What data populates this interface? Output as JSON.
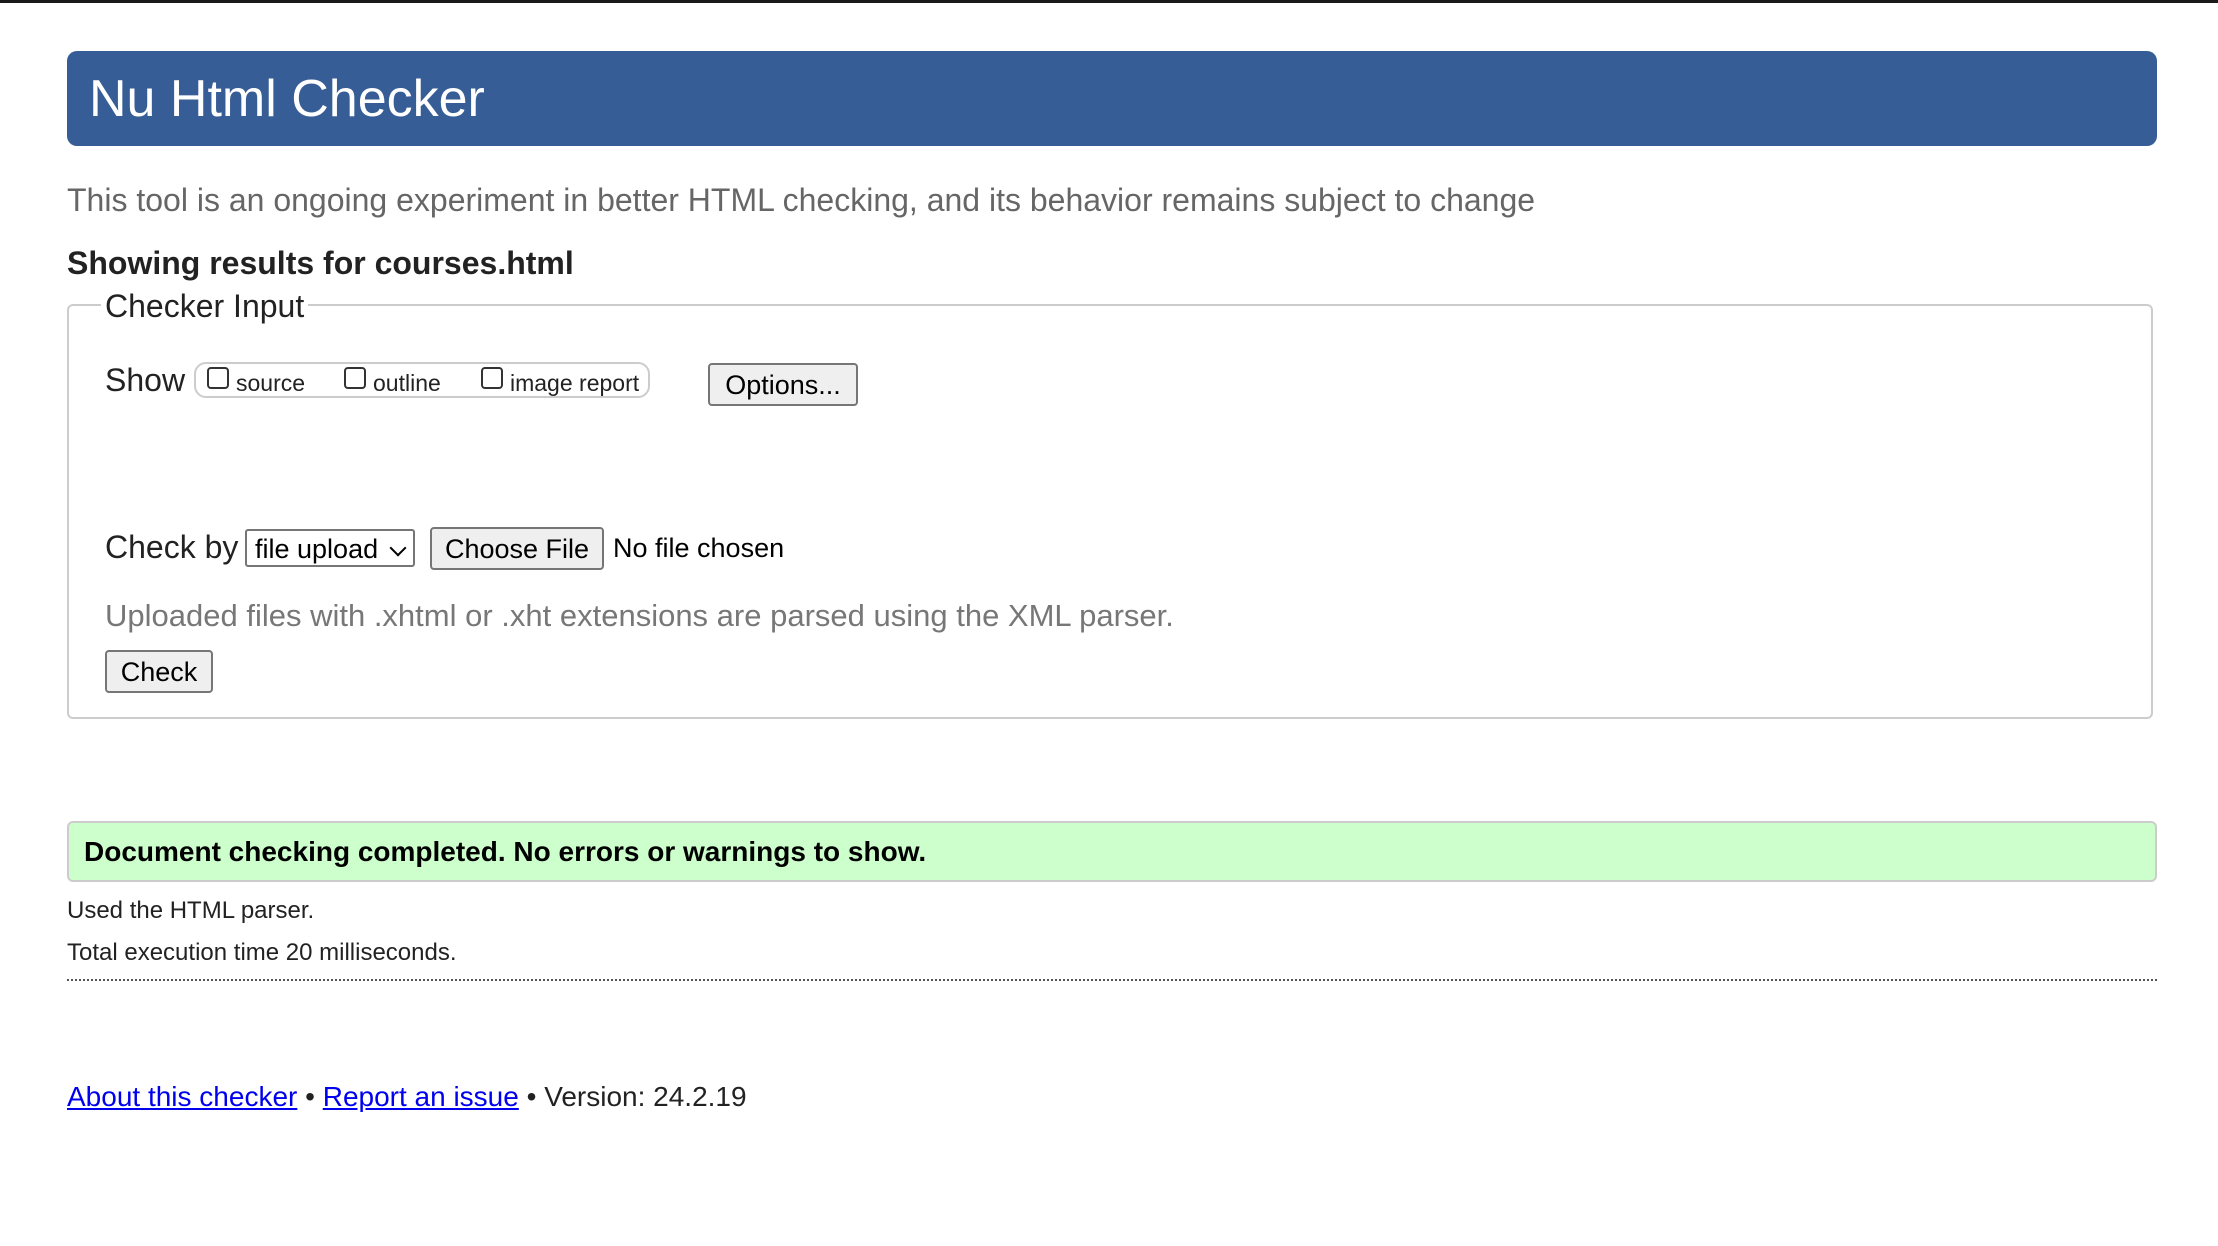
{
  "header": {
    "title": "Nu Html Checker"
  },
  "intro": "This tool is an ongoing experiment in better HTML checking, and its behavior remains subject to change",
  "results_title": "Showing results for courses.html",
  "checker_input": {
    "legend": "Checker Input",
    "show_label": "Show",
    "show_options": [
      {
        "label": "source",
        "checked": false
      },
      {
        "label": "outline",
        "checked": false
      },
      {
        "label": "image report",
        "checked": false
      }
    ],
    "options_button": "Options...",
    "check_by_label": "Check by",
    "check_by_value": "file upload",
    "choose_file_button": "Choose File",
    "no_file_text": "No file chosen",
    "hint": "Uploaded files with .xhtml or .xht extensions are parsed using the XML parser.",
    "check_button": "Check"
  },
  "result": {
    "message": "Document checking completed. No errors or warnings to show.",
    "parser_info": "Used the HTML parser.",
    "execution_time": "Total execution time 20 milliseconds."
  },
  "footer": {
    "about_link": "About this checker",
    "separator": "•",
    "report_link": "Report an issue",
    "version": "Version: 24.2.19"
  },
  "colors": {
    "banner": "#365d95",
    "success_bg": "#ccffcc",
    "link": "#0000ee"
  }
}
